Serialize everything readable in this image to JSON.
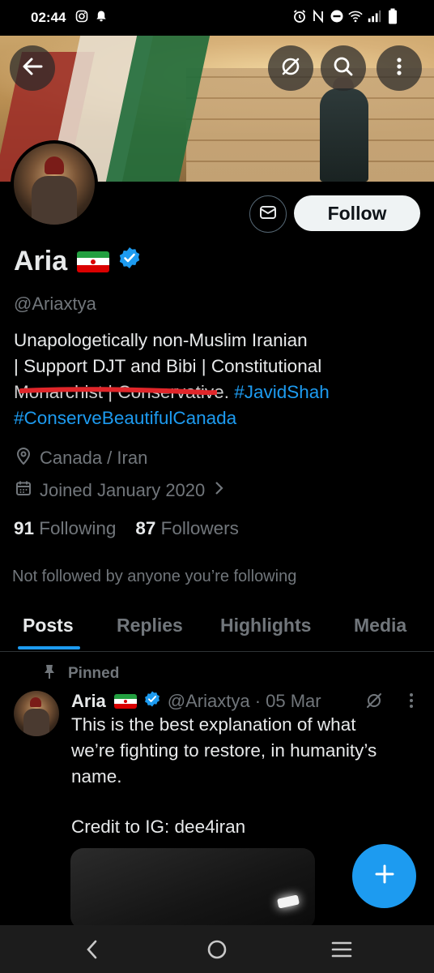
{
  "status_bar": {
    "time": "02:44",
    "left_icons": [
      "instagram-icon",
      "bell-icon"
    ],
    "right_icons": [
      "alarm-icon",
      "nfc-icon",
      "dnd-icon",
      "wifi-icon",
      "signal-icon",
      "battery-icon"
    ]
  },
  "header": {
    "back_icon": "arrow-left-icon",
    "mute_icon": "mute-notifications-icon",
    "search_icon": "search-icon",
    "more_icon": "more-vertical-icon"
  },
  "profile": {
    "name": "Aria",
    "flag": "Iran flag",
    "verified": true,
    "handle": "@Ariaxtya",
    "follow_label": "Follow",
    "message_icon": "envelope-icon",
    "bio": {
      "line1": "Unapologetically non-Muslim Iranian",
      "line2": "| Support DJT and Bibi | Constitutional",
      "line3_struck": "Monarchist | Conservative.",
      "line3_hashtag": "#JavidShah",
      "line4_hashtag": "#ConserveBeautifulCanada"
    },
    "location": "Canada / Iran",
    "joined": "Joined January 2020",
    "following_count": "91",
    "following_label": "Following",
    "followers_count": "87",
    "followers_label": "Followers",
    "not_followed": "Not followed by anyone you’re following"
  },
  "tabs": [
    {
      "label": "Posts",
      "active": true
    },
    {
      "label": "Replies",
      "active": false
    },
    {
      "label": "Highlights",
      "active": false
    },
    {
      "label": "Media",
      "active": false
    }
  ],
  "pinned_post": {
    "pinned_label": "Pinned",
    "author": "Aria",
    "meta": "@Ariaxtya · 05 Mar",
    "text_lines": [
      "This is the best explanation of what",
      "we’re fighting to restore, in humanity’s",
      "name."
    ],
    "credit": "Credit to IG: dee4iran"
  },
  "fab_icon": "plus-icon",
  "nav_bar": {
    "back_icon": "chevron-left-icon",
    "home_icon": "circle-home-icon",
    "recents_icon": "menu-lines-icon"
  },
  "colors": {
    "accent": "#1d9bf0",
    "muted_text": "#71767b",
    "background": "#000000",
    "strike": "#e0262a"
  }
}
